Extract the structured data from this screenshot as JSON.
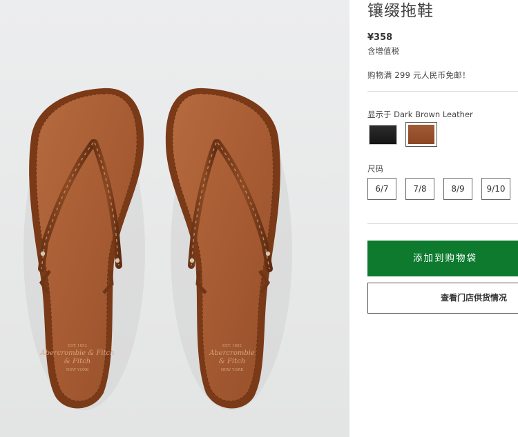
{
  "product": {
    "title": "镶缀拖鞋",
    "image_alt": "Abercrombie & Fitch"
  },
  "price": {
    "amount": "¥358",
    "tax_note": "含增值税"
  },
  "promo": "购物满 299 元人民币免邮！",
  "color": {
    "label": "显示于 Dark Brown Leather",
    "swatches": [
      {
        "name": "black",
        "color": "#1d1d1d",
        "selected": false
      },
      {
        "name": "dark-brown-leather",
        "color": "#96502c",
        "selected": true
      }
    ]
  },
  "size": {
    "label": "尺码",
    "options": [
      "6/7",
      "7/8",
      "8/9",
      "9/10"
    ]
  },
  "actions": {
    "add_to_bag": "添加到购物袋",
    "store_availability": "查看门店供货情况"
  },
  "colors": {
    "accent_green": "#0d7a2e",
    "background": "#ffffff"
  }
}
